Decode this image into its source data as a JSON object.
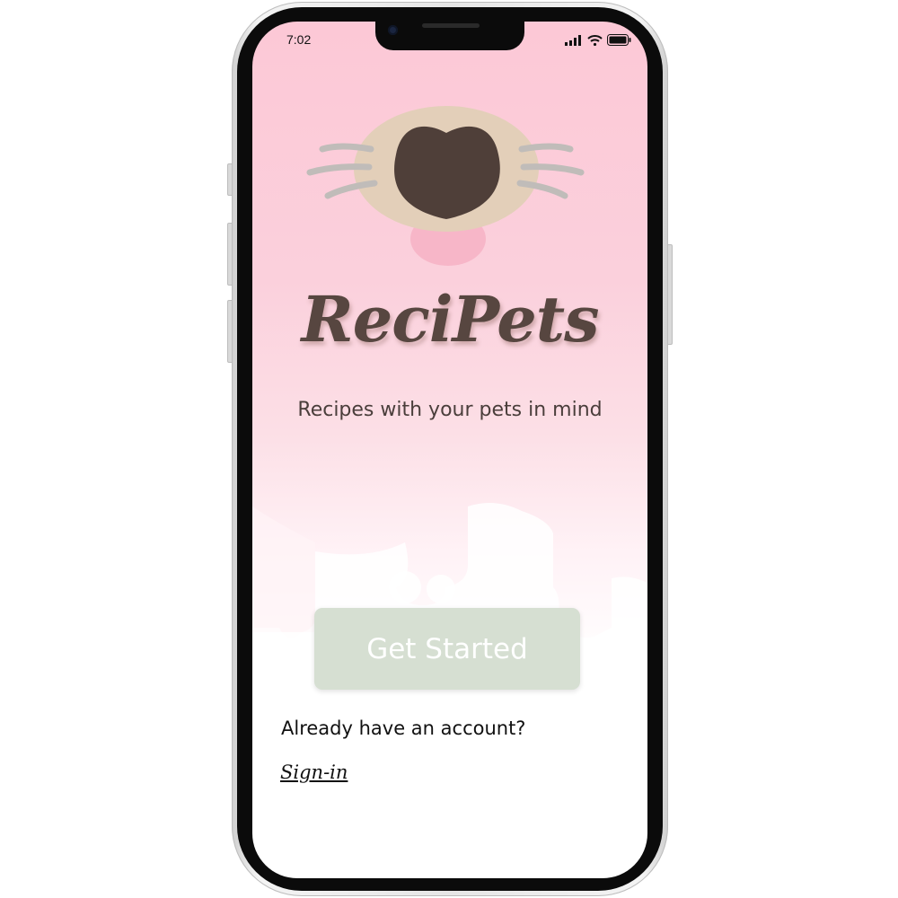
{
  "status_bar": {
    "time": "7:02",
    "signal_icon": "signal-bars-icon",
    "wifi_icon": "wifi-icon",
    "battery_icon": "battery-icon"
  },
  "app": {
    "logo_icon": "pet-nose-icon",
    "name": "ReciPets",
    "tagline": "Recipes with your pets in mind"
  },
  "actions": {
    "get_started_label": "Get Started",
    "account_prompt": "Already have an account?",
    "signin_label": "Sign-in"
  },
  "colors": {
    "background_top": "#fcc8d6",
    "brand_text": "#574640",
    "button": "#d6dfd2",
    "nose": "#4f3f39",
    "muzzle": "#e3cfb9",
    "tongue": "#f7b6c8",
    "whiskers": "#c0bcb9"
  }
}
